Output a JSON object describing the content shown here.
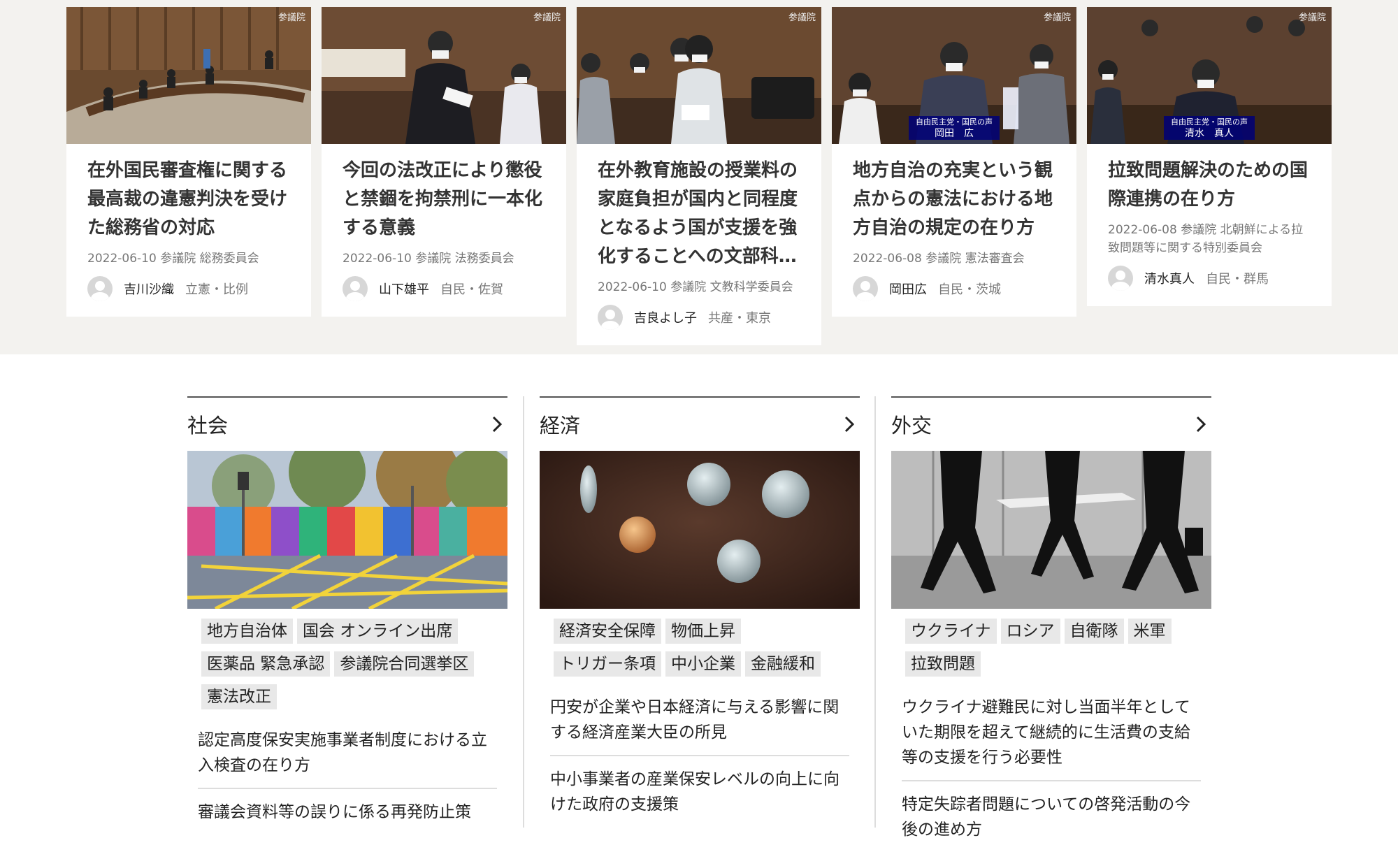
{
  "cards": [
    {
      "house": "参議院",
      "title": "在外国民審査権に関する最高裁の違憲判決を受けた総務省の対応",
      "meta": "2022-06-10 参議院 総務委員会",
      "speaker": "吉川沙織",
      "party": "立憲・比例"
    },
    {
      "house": "参議院",
      "title": "今回の法改正により懲役と禁錮を拘禁刑に一本化する意義",
      "meta": "2022-06-10 参議院 法務委員会",
      "speaker": "山下雄平",
      "party": "自民・佐賀"
    },
    {
      "house": "参議院",
      "title": "在外教育施設の授業料の家庭負担が国内と同程度となるよう国が支援を強化することへの文部科…",
      "meta": "2022-06-10 参議院 文教科学委員会",
      "speaker": "吉良よし子",
      "party": "共産・東京"
    },
    {
      "house": "参議院",
      "caption_party": "自由民主党・国民の声",
      "caption_name": "岡田　広",
      "title": "地方自治の充実という観点からの憲法における地方自治の規定の在り方",
      "meta": "2022-06-08 参議院 憲法審査会",
      "speaker": "岡田広",
      "party": "自民・茨城"
    },
    {
      "house": "参議院",
      "caption_party": "自由民主党・国民の声",
      "caption_name": "清水　真人",
      "title": "拉致問題解決のための国際連携の在り方",
      "meta": "2022-06-08 参議院 北朝鮮による拉致問題等に関する特別委員会",
      "speaker": "清水真人",
      "party": "自民・群馬"
    }
  ],
  "categories": [
    {
      "label": "社会",
      "tags": [
        "地方自治体",
        "国会 オンライン出席",
        "医薬品 緊急承認",
        "参議院合同選挙区",
        "憲法改正"
      ],
      "links": [
        "認定高度保安実施事業者制度における立入検査の在り方",
        "審議会資料等の誤りに係る再発防止策"
      ]
    },
    {
      "label": "経済",
      "tags": [
        "経済安全保障",
        "物価上昇",
        "トリガー条項",
        "中小企業",
        "金融緩和"
      ],
      "links": [
        "円安が企業や日本経済に与える影響に関する経済産業大臣の所見",
        "中小事業者の産業保安レベルの向上に向けた政府の支援策"
      ]
    },
    {
      "label": "外交",
      "tags": [
        "ウクライナ",
        "ロシア",
        "自衛隊",
        "米軍",
        "拉致問題"
      ],
      "links": [
        "ウクライナ避難民に対し当面半年としていた期限を超えて継続的に生活費の支給等の支援を行う必要性",
        "特定失踪者問題についての啓発活動の今後の進め方"
      ]
    }
  ],
  "icons": {
    "chevron": "chevron-right-icon",
    "avatar": "user-avatar-icon"
  },
  "colors": {
    "band_background": "#f3f2ef",
    "caption_blue": "#00007a",
    "tag_background": "#e8e8e8"
  }
}
